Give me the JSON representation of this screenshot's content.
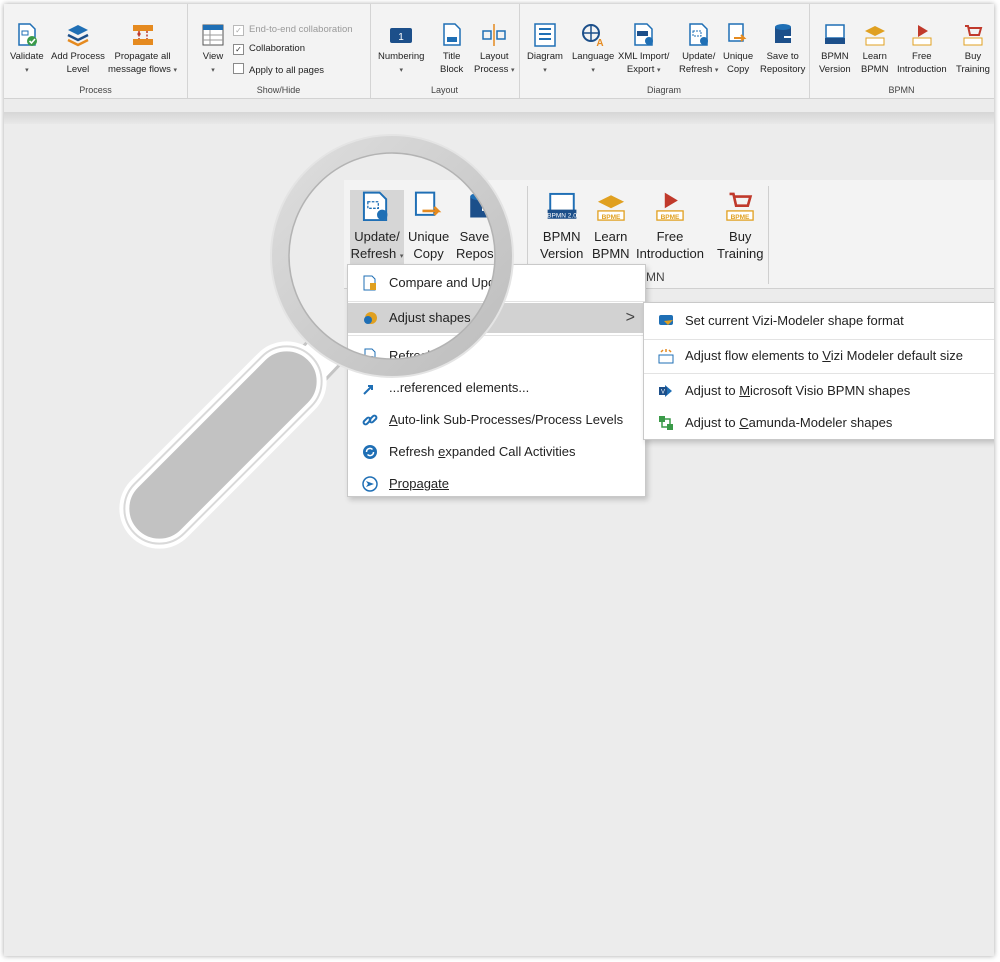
{
  "ribbon": {
    "groups": {
      "process": "Process",
      "showhide": "Show/Hide",
      "layout": "Layout",
      "diagram": "Diagram",
      "bpmn": "BPMN"
    },
    "buttons": {
      "validate": "Validate",
      "add_process_1": "Add Process",
      "add_process_2": "Level",
      "propagate_1": "Propagate all",
      "propagate_2": "message flows",
      "view": "View",
      "numbering": "Numbering",
      "title_1": "Title",
      "title_2": "Block",
      "layout_1": "Layout",
      "layout_2": "Process",
      "diagram": "Diagram",
      "language": "Language",
      "xml_1": "XML Import/",
      "xml_2": "Export",
      "update_1": "Update/",
      "update_2": "Refresh",
      "unique_1": "Unique",
      "unique_2": "Copy",
      "save_1": "Save to",
      "save_2": "Repository",
      "bpmn_v_1": "BPMN",
      "bpmn_v_2": "Version",
      "learn_1": "Learn",
      "learn_2": "BPMN",
      "free_1": "Free",
      "free_2": "Introduction",
      "buy_1": "Buy",
      "buy_2": "Training"
    },
    "checkboxes": {
      "e2e": "End-to-end collaboration",
      "collab": "Collaboration",
      "apply": "Apply to all pages"
    },
    "caret": "▾"
  },
  "zoom": {
    "update_1": "Update/",
    "update_2": "Refresh",
    "unique_1": "Unique",
    "unique_2": "Copy",
    "save_1": "Save to",
    "save_2": "Reposito",
    "bpmn_1": "BPMN",
    "bpmn_2": "Version",
    "learn_1": "Learn",
    "learn_2": "BPMN",
    "free_1": "Free",
    "free_2": "Introduction",
    "buy_1": "Buy",
    "buy_2": "Training",
    "group_label": "MN",
    "icon_bpmn20": "BPMN 2.0",
    "icon_bpme": "BPME"
  },
  "menu": {
    "compare": "Compare and Upda",
    "adjust": "Adjust shapes...",
    "refresh": "Refresh Di",
    "referenced": "...referenced elements...",
    "autolink_u": "A",
    "autolink_rest": "uto-link Sub-Processes/Process Levels",
    "refresh_exp_1": "Refresh ",
    "refresh_exp_u": "e",
    "refresh_exp_2": "xpanded Call Activities",
    "propagate": "Propagate",
    "arrow": ">"
  },
  "submenu": {
    "set_format": "Set current Vizi-Modeler shape format",
    "adjust_flow_1": "Adjust flow elements to ",
    "adjust_flow_u": "V",
    "adjust_flow_2": "izi Modeler default size",
    "visio_1": "Adjust to ",
    "visio_u": "M",
    "visio_2": "icrosoft Visio BPMN shapes",
    "camunda_1": "Adjust to ",
    "camunda_u": "C",
    "camunda_2": "amunda-Modeler shapes"
  },
  "colors": {
    "accent_blue": "#1f6fb5",
    "dark_blue": "#1c4f8a",
    "orange": "#e58a1f",
    "gold": "#e0a020",
    "red": "#c0392b",
    "green": "#3a9a48",
    "menu_highlight": "#d2d2d2",
    "magnifier": "#c9c9c9"
  }
}
